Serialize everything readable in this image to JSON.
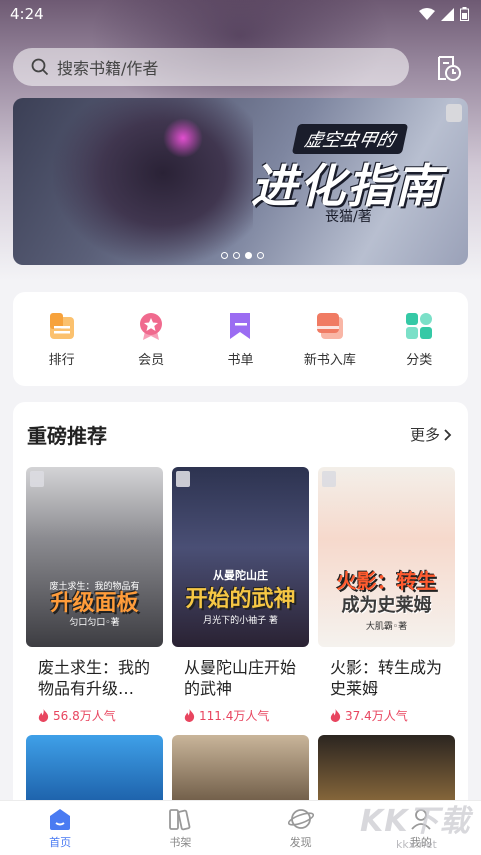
{
  "status_bar": {
    "time": "4:24"
  },
  "search": {
    "placeholder": "搜索书籍/作者"
  },
  "banner": {
    "subtitle": "虚空虫甲的",
    "title": "进化指南",
    "author": "丧猫/著",
    "page_count": 4,
    "active_index": 2
  },
  "quick_menu": [
    {
      "label": "排行",
      "icon": "ranking-icon",
      "color": "#f7a23b"
    },
    {
      "label": "会员",
      "icon": "vip-badge-icon",
      "color": "#f06a8e"
    },
    {
      "label": "书单",
      "icon": "booklist-icon",
      "color": "#9b6cf2"
    },
    {
      "label": "新书入库",
      "icon": "new-books-icon",
      "color": "#f07b63"
    },
    {
      "label": "分类",
      "icon": "category-icon",
      "color": "#35c9a6"
    }
  ],
  "recommend": {
    "title": "重磅推荐",
    "more": "更多",
    "books": [
      {
        "cover_title": "升级面板",
        "cover_sub": "废土求生：我的物品有",
        "cover_author": "匀口匀口◦著",
        "name": "废土求生：我的物品有升级…",
        "popularity": "56.8万人气"
      },
      {
        "cover_title": "开始的武神",
        "cover_sub": "从曼陀山庄",
        "cover_author": "月光下的小袖子 著",
        "name": "从曼陀山庄开始的武神",
        "popularity": "111.4万人气"
      },
      {
        "cover_title": "火影：转生",
        "cover_sub": "成为史莱姆",
        "cover_author": "大肌霸◦著",
        "name": "火影：转生成为史莱姆",
        "popularity": "37.4万人气"
      }
    ]
  },
  "tabbar": [
    {
      "label": "首页",
      "icon": "home-icon",
      "active": true
    },
    {
      "label": "书架",
      "icon": "bookshelf-icon",
      "active": false
    },
    {
      "label": "发现",
      "icon": "discover-icon",
      "active": false
    },
    {
      "label": "我的",
      "icon": "profile-icon",
      "active": false
    }
  ],
  "watermark": {
    "text": "KK下载",
    "sub": "kkx.net"
  },
  "colors": {
    "accent": "#4a7bf2",
    "popularity": "#e8455f"
  }
}
